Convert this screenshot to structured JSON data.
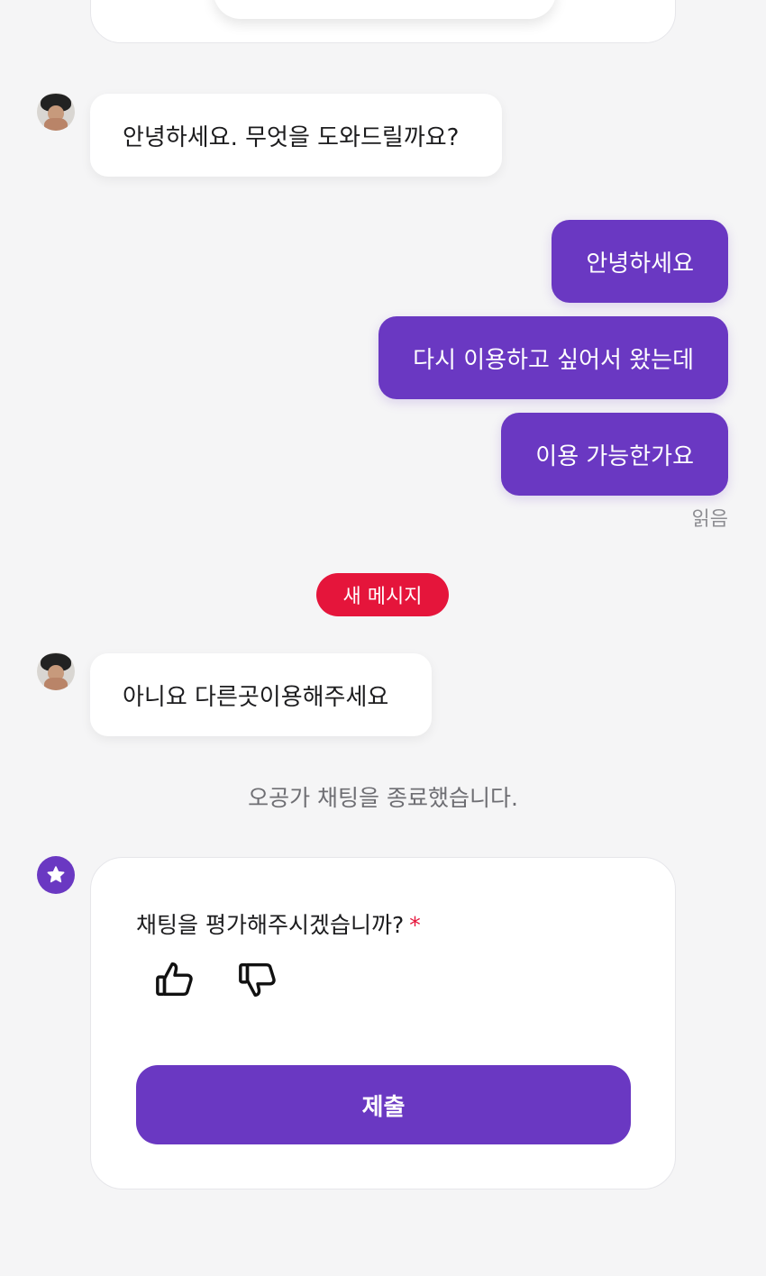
{
  "messages_incoming": [
    {
      "text": "안녕하세요. 무엇을 도와드릴까요?"
    },
    {
      "text": "아니요 다른곳이용해주세요"
    }
  ],
  "messages_outgoing": [
    {
      "text": "안녕하세요"
    },
    {
      "text": "다시 이용하고 싶어서 왔는데"
    },
    {
      "text": "이용 가능한가요"
    }
  ],
  "read_status": "읽음",
  "new_message_divider": "새 메시지",
  "system_message": "오공가 채팅을 종료했습니다.",
  "rating": {
    "question": "채팅을 평가해주시겠습니까?",
    "required_mark": "*",
    "thumbs_up_icon": "thumbs-up-icon",
    "thumbs_down_icon": "thumbs-down-icon",
    "submit_label": "제출"
  },
  "colors": {
    "accent": "#6a38c2",
    "new_message": "#e5153b",
    "background": "#f5f5f6"
  }
}
